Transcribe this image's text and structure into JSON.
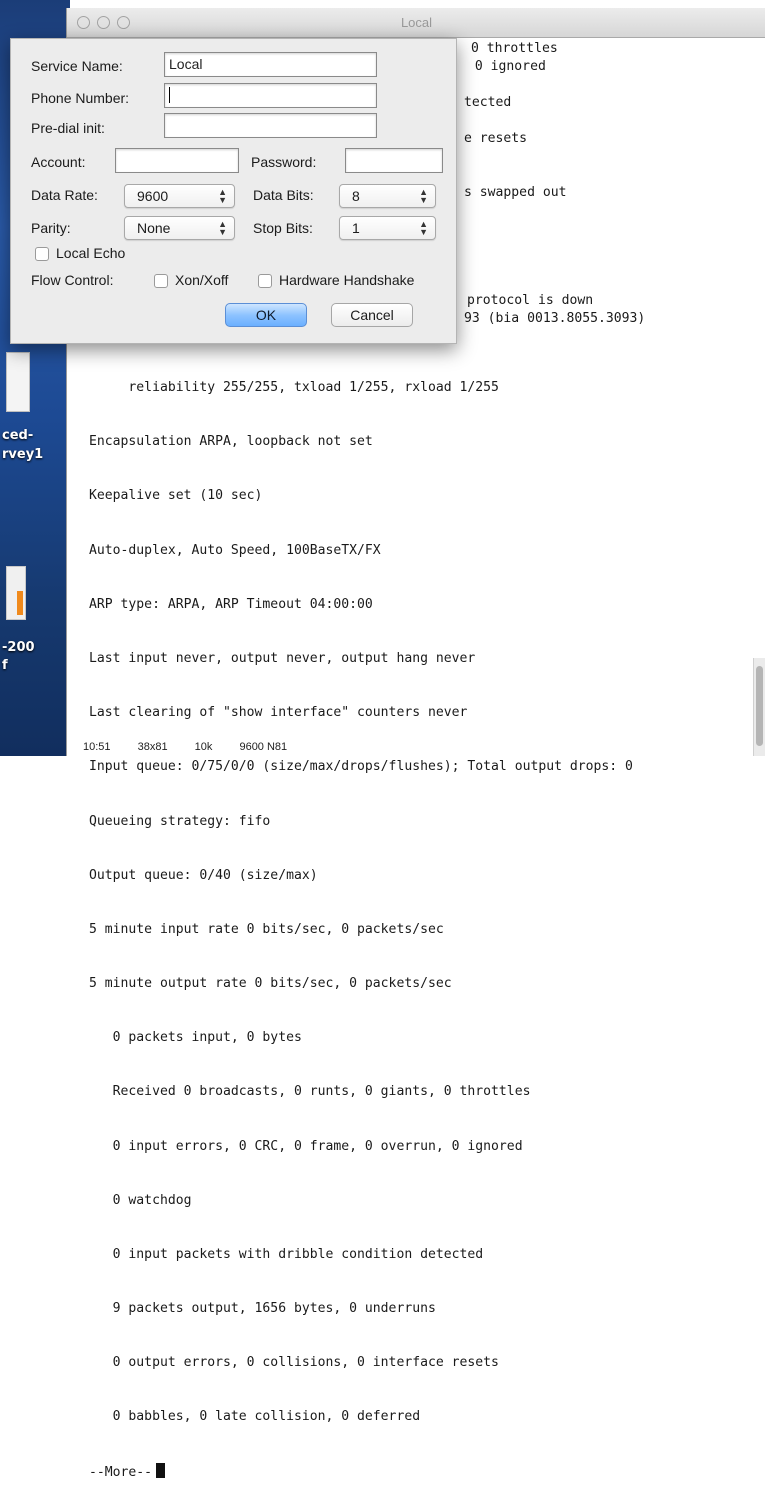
{
  "desktop": {
    "labels": [
      "ced-",
      "rvey1",
      "-200",
      "f"
    ]
  },
  "window": {
    "title": "Local",
    "terminal_lines": [
      "     reliability 255/255, txload 1/255, rxload 1/255",
      "Encapsulation ARPA, loopback not set",
      "Keepalive set (10 sec)",
      "Auto-duplex, Auto Speed, 100BaseTX/FX",
      "ARP type: ARPA, ARP Timeout 04:00:00",
      "Last input never, output never, output hang never",
      "Last clearing of \"show interface\" counters never",
      "Input queue: 0/75/0/0 (size/max/drops/flushes); Total output drops: 0",
      "Queueing strategy: fifo",
      "Output queue: 0/40 (size/max)",
      "5 minute input rate 0 bits/sec, 0 packets/sec",
      "5 minute output rate 0 bits/sec, 0 packets/sec",
      "   0 packets input, 0 bytes",
      "   Received 0 broadcasts, 0 runts, 0 giants, 0 throttles",
      "   0 input errors, 0 CRC, 0 frame, 0 overrun, 0 ignored",
      "   0 watchdog",
      "   0 input packets with dribble condition detected",
      "   9 packets output, 1656 bytes, 0 underruns",
      "   0 output errors, 0 collisions, 0 interface resets",
      "   0 babbles, 0 late collision, 0 deferred"
    ],
    "more_prompt": "--More--",
    "behind_dialog_lines": {
      "l1": "0 throttles",
      "l2": " 0 ignored",
      "l3": "tected",
      "l4": "e resets",
      "l5": "s swapped out",
      "l6": "protocol is down",
      "l7": "93 (bia 0013.8055.3093)"
    },
    "status": {
      "time": "10:51",
      "size": "38x81",
      "buffer": "10k",
      "line": "9600 N81"
    }
  },
  "dialog": {
    "service_name_label": "Service Name:",
    "service_name_value": "Local",
    "phone_number_label": "Phone Number:",
    "phone_number_value": "",
    "predial_label": "Pre-dial init:",
    "predial_value": "",
    "account_label": "Account:",
    "account_value": "",
    "password_label": "Password:",
    "password_value": "",
    "data_rate_label": "Data Rate:",
    "data_rate_value": "9600",
    "data_bits_label": "Data Bits:",
    "data_bits_value": "8",
    "parity_label": "Parity:",
    "parity_value": "None",
    "stop_bits_label": "Stop Bits:",
    "stop_bits_value": "1",
    "local_echo_label": "Local Echo",
    "local_echo_checked": false,
    "flow_control_label": "Flow Control:",
    "xon_xoff_label": "Xon/Xoff",
    "xon_xoff_checked": false,
    "hardware_handshake_label": "Hardware Handshake",
    "hardware_handshake_checked": false,
    "ok_label": "OK",
    "cancel_label": "Cancel"
  },
  "colors": {
    "ok_button": "#8ec3ff",
    "desktop": "#1d4a94"
  }
}
